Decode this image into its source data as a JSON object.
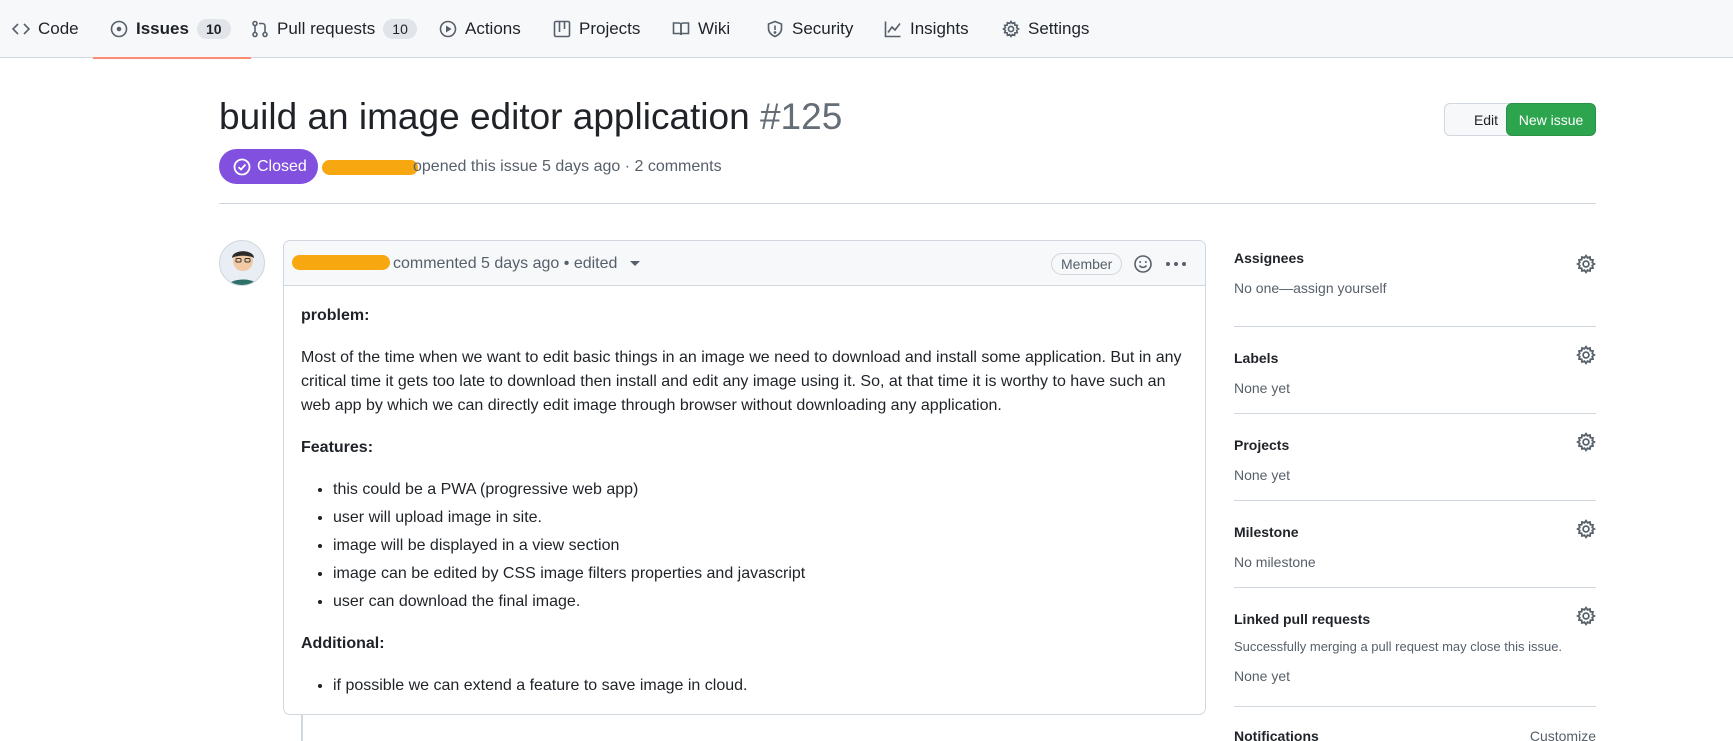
{
  "nav": {
    "code": "Code",
    "issues": "Issues",
    "issues_count": "10",
    "pulls": "Pull requests",
    "pulls_count": "10",
    "actions": "Actions",
    "projects": "Projects",
    "wiki": "Wiki",
    "security": "Security",
    "insights": "Insights",
    "settings": "Settings"
  },
  "issue": {
    "title": "build an image editor application",
    "number": "#125",
    "state": "Closed",
    "meta": "opened this issue 5 days ago · 2 comments",
    "edit_label": "Edit",
    "new_issue_label": "New issue"
  },
  "comment": {
    "meta": "commented 5 days ago • edited",
    "role_badge": "Member",
    "problem_heading": "problem:",
    "problem_text": "Most of the time when we want to edit basic things in an image we need to download and install some application. But in any critical time it gets too late to download then install and edit any image using it. So, at that time it is worthy to have such an web app by which we can directly edit image through browser without downloading any application.",
    "features_heading": "Features:",
    "features": [
      "this could be a PWA (progressive web app)",
      "user will upload image in site.",
      "image will be displayed in a view section",
      "image can be edited by CSS image filters properties and javascript",
      "user can download the final image."
    ],
    "additional_heading": "Additional:",
    "additional": [
      "if possible we can extend a feature to save image in cloud."
    ]
  },
  "sidebar": {
    "assignees_label": "Assignees",
    "assignees_value": "No one—assign yourself",
    "labels_label": "Labels",
    "labels_value": "None yet",
    "projects_label": "Projects",
    "projects_value": "None yet",
    "milestone_label": "Milestone",
    "milestone_value": "No milestone",
    "linked_label": "Linked pull requests",
    "linked_hint": "Successfully merging a pull request may close this issue.",
    "linked_value": "None yet",
    "notifications_label": "Notifications",
    "customize_label": "Customize"
  },
  "colors": {
    "closed_purple": "#8250df",
    "new_issue_green": "#2da44e",
    "active_tab_underline": "#fd8c73",
    "redaction": "#f7a70f"
  },
  "icons": [
    "code-icon",
    "issue-icon",
    "pull-request-icon",
    "play-icon",
    "table-icon",
    "book-icon",
    "shield-icon",
    "graph-icon",
    "gear-icon",
    "check-circle-icon",
    "smiley-icon",
    "kebab-icon"
  ]
}
